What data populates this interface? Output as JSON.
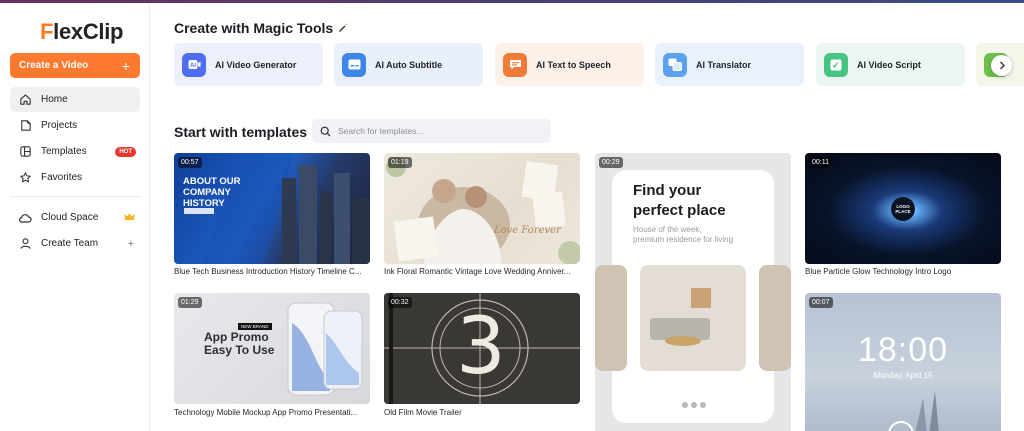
{
  "brand": {
    "name_first": "F",
    "name_rest": "lexClip"
  },
  "sidebar": {
    "create_label": "Create a Video",
    "create_plus": "+",
    "items": [
      {
        "label": "Home",
        "icon": "home-icon"
      },
      {
        "label": "Projects",
        "icon": "projects-icon"
      },
      {
        "label": "Templates",
        "icon": "templates-icon",
        "badge": "HOT"
      },
      {
        "label": "Favorites",
        "icon": "star-icon"
      },
      {
        "label": "Cloud Space",
        "icon": "cloud-icon"
      },
      {
        "label": "Create Team",
        "icon": "user-icon",
        "right": "+"
      }
    ]
  },
  "magic": {
    "title": "Create with Magic Tools",
    "tools": [
      {
        "label": "AI Video Generator",
        "bg": "#edf0fb",
        "icon_color": "#4f6df0"
      },
      {
        "label": "AI Auto Subtitle",
        "bg": "#eaf0fb",
        "icon_color": "#3d86e8"
      },
      {
        "label": "AI Text to Speech",
        "bg": "#fdf0e8",
        "icon_color": "#f07a38"
      },
      {
        "label": "AI Translator",
        "bg": "#e9f2fc",
        "icon_color": "#5aa2ee"
      },
      {
        "label": "AI Video Script",
        "bg": "#eaf6ef",
        "icon_color": "#47c482"
      }
    ]
  },
  "templates": {
    "title": "Start with templates",
    "search_placeholder": "Search for templates...",
    "cards": [
      {
        "duration": "00:57",
        "caption": "Blue Tech Business Introduction History Timeline C...",
        "overlay": [
          "ABOUT OUR",
          "COMPANY",
          "HISTORY"
        ]
      },
      {
        "duration": "01:19",
        "caption": "Ink Floral Romantic Vintage Love Wedding Anniver...",
        "overlay": [
          "Love Forever"
        ]
      },
      {
        "duration": "00:29",
        "caption": "",
        "overlay": [
          "Find your",
          "perfect place",
          "House of the week,",
          "premium residence for living"
        ]
      },
      {
        "duration": "00:11",
        "caption": "Blue Particle Glow Technology Intro Logo",
        "overlay": [
          "LOGO",
          "PLACE"
        ]
      },
      {
        "duration": "01:29",
        "caption": "Technology Mobile Mockup App Promo Presentati...",
        "overlay": [
          "NEW BRAND",
          "App Promo",
          "Easy To Use"
        ]
      },
      {
        "duration": "00:32",
        "caption": "Old Film Movie Trailer",
        "overlay": [
          "3"
        ]
      },
      {
        "duration": "00:07",
        "caption": "",
        "overlay": [
          "18:00",
          "Monday, April 15"
        ]
      }
    ]
  }
}
